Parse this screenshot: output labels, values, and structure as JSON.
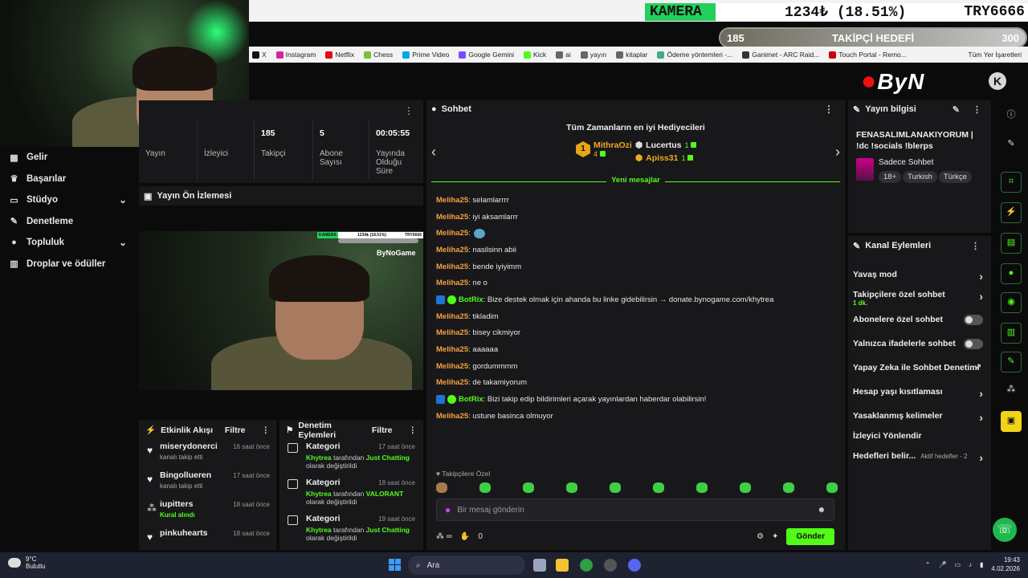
{
  "overlay": {
    "kamera_label": "KAMERA",
    "kamera_value": "1234₺ (18.51%)",
    "kamera_ticker": "TRY6666",
    "goal_current": "185",
    "goal_label": "TAKİPÇİ HEDEFİ",
    "goal_target": "300"
  },
  "bookmarks": [
    "X",
    "Instagram",
    "Netflix",
    "Chess",
    "Prime Video",
    "Google Gemini",
    "Kick",
    "ai",
    "yayın",
    "kitaplar",
    "Ödeme yöntemleri -...",
    "Ganimet - ARC Raid...",
    "Touch Portal - Remo..."
  ],
  "bookmarks_all": "Tüm Yer İşaretleri",
  "bookmark_colors": [
    "#111",
    "#d6249f",
    "#e50914",
    "#7bbf3a",
    "#00a8e1",
    "#7c4dff",
    "#53fc18",
    "#666",
    "#666",
    "#666",
    "#4a8",
    "#333",
    "#c00"
  ],
  "logo": {
    "text": "ByN"
  },
  "nav": {
    "items": [
      {
        "label": "Gelir",
        "icon": "revenue-icon",
        "glyph": "▦",
        "chevron": false
      },
      {
        "label": "Başarılar",
        "icon": "trophy-icon",
        "glyph": "♛",
        "chevron": false
      },
      {
        "label": "Stüdyo",
        "icon": "studio-icon",
        "glyph": "▭",
        "chevron": true
      },
      {
        "label": "Denetleme",
        "icon": "wrench-icon",
        "glyph": "✎",
        "chevron": false
      },
      {
        "label": "Topluluk",
        "icon": "community-icon",
        "glyph": "●",
        "chevron": true
      },
      {
        "label": "Droplar ve ödüller",
        "icon": "drops-icon",
        "glyph": "▥",
        "chevron": false
      }
    ]
  },
  "stats": [
    {
      "value": "",
      "label": "Yayın"
    },
    {
      "value": "",
      "label": "İzleyici"
    },
    {
      "value": "185",
      "label": "Takipçi"
    },
    {
      "value": "5",
      "label": "Abone Sayısı"
    },
    {
      "value": "00:05:55",
      "label": "Yayında Olduğu Süre"
    }
  ],
  "preview": {
    "title": "Yayın Ön İzlemesi",
    "mini_label": "KAMERA",
    "mini_value": "1234₺ (18.51%)",
    "mini_ticker": "TRY6666",
    "mini_logo": "ByNoGame"
  },
  "activity": {
    "title": "Etkinlik Akışı",
    "filter": "Filtre",
    "items": [
      {
        "name": "miserydonerci",
        "sub": "kanalı takip etti",
        "time": "16 saat önce",
        "icon": "heart-icon",
        "glyph": "♥",
        "green": false
      },
      {
        "name": "Bingollueren",
        "sub": "kanalı takip etti",
        "time": "17 saat önce",
        "icon": "heart-icon",
        "glyph": "♥",
        "green": false
      },
      {
        "name": "iupitters",
        "sub": "Kural alındı",
        "time": "18 saat önce",
        "icon": "reward-icon",
        "glyph": "⁂",
        "green": true
      },
      {
        "name": "pinkuhearts",
        "sub": "",
        "time": "18 saat önce",
        "icon": "heart-icon",
        "glyph": "♥",
        "green": false
      }
    ]
  },
  "modactions": {
    "title": "Denetim Eylemleri",
    "filter": "Filtre",
    "items": [
      {
        "name": "Kategori",
        "time": "17 saat önce",
        "user": "Khytrea",
        "mid": " tarafından ",
        "value": "Just Chatting",
        "end": "olarak değiştirildi"
      },
      {
        "name": "Kategori",
        "time": "18 saat önce",
        "user": "Khytrea",
        "mid": " tarafından ",
        "value": "VALORANT",
        "end": "olarak değiştirildi"
      },
      {
        "name": "Kategori",
        "time": "19 saat önce",
        "user": "Khytrea",
        "mid": " tarafından ",
        "value": "Just Chatting",
        "end": "olarak değiştirildi"
      }
    ]
  },
  "chat": {
    "title": "Sohbet",
    "top_gifters_title": "Tüm Zamanların en iyi Hediyecileri",
    "gifters": [
      {
        "rank": "1",
        "name": "MithraOzi",
        "count": "4"
      },
      {
        "name": "Lucertus",
        "count": "1"
      },
      {
        "name": "Apiss31",
        "count": "1"
      }
    ],
    "new_messages": "Yeni mesajlar",
    "messages": [
      {
        "user": "Meliha25",
        "text": ": selamlarrrr",
        "bot": false,
        "emote": false
      },
      {
        "user": "Meliha25",
        "text": ": iyi aksamlarrr",
        "bot": false,
        "emote": false
      },
      {
        "user": "Meliha25",
        "text": ":",
        "bot": false,
        "emote": true
      },
      {
        "user": "Meliha25",
        "text": ": nasilsinn abii",
        "bot": false,
        "emote": false
      },
      {
        "user": "Meliha25",
        "text": ": bende iyiyimm",
        "bot": false,
        "emote": false
      },
      {
        "user": "Meliha25",
        "text": ": ne o",
        "bot": false,
        "emote": false
      },
      {
        "user": "BotRix",
        "text": ": Bize destek olmak için ahanda bu linke gidebilirsin → donate.bynogame.com/khytrea",
        "bot": true,
        "emote": false
      },
      {
        "user": "Meliha25",
        "text": ": tikladim",
        "bot": false,
        "emote": false
      },
      {
        "user": "Meliha25",
        "text": ": bisey cikmiyor",
        "bot": false,
        "emote": false
      },
      {
        "user": "Meliha25",
        "text": ": aaaaaa",
        "bot": false,
        "emote": false
      },
      {
        "user": "Meliha25",
        "text": ": gordummmm",
        "bot": false,
        "emote": false
      },
      {
        "user": "Meliha25",
        "text": ": de takamiyorum",
        "bot": false,
        "emote": false
      },
      {
        "user": "BotRix",
        "text": ": Bizi takip edip bildirimleri açarak yayınlardan haberdar olabilirsin!",
        "bot": true,
        "emote": false
      },
      {
        "user": "Meliha25",
        "text": ": ustune basinca olmuyor",
        "bot": false,
        "emote": false
      }
    ],
    "followers_only": "Takipçilere Özel",
    "input_placeholder": "Bir mesaj gönderin",
    "count": "0",
    "send": "Gönder"
  },
  "info": {
    "title": "Yayın bilgisi",
    "stream_title": "FENASALIMLANAKIYORUM | !dc !socials !blerps",
    "category": "Sadece Sohbet",
    "tags": [
      "18+",
      "Turkish",
      "Türkçe"
    ]
  },
  "channel_actions": {
    "title": "Kanal Eylemleri",
    "items": [
      {
        "label": "Yavaş mod",
        "control": "arrow",
        "sub": ""
      },
      {
        "label": "Takipçilere özel sohbet",
        "control": "arrow",
        "sub": "1 dk."
      },
      {
        "label": "Abonelere özel sohbet",
        "control": "toggle",
        "sub": ""
      },
      {
        "label": "Yalnızca ifadelerle sohbet",
        "control": "toggle",
        "sub": ""
      },
      {
        "label": "Yapay Zeka ile Sohbet Denetimi",
        "control": "external",
        "sub": ""
      },
      {
        "label": "Hesap yaşı kısıtlaması",
        "control": "arrow",
        "sub": ""
      },
      {
        "label": "Yasaklanmış kelimeler",
        "control": "arrow",
        "sub": ""
      },
      {
        "label": "İzleyici Yönlendir",
        "control": "none",
        "sub": ""
      },
      {
        "label": "Hedefleri belir...",
        "control": "arrow",
        "sub": "Aktif hedefler - 2"
      }
    ]
  },
  "taskbar": {
    "temp": "9°C",
    "weather": "Bulutlu",
    "search": "Ara",
    "time": "19:43",
    "date": "4.02.2026"
  }
}
